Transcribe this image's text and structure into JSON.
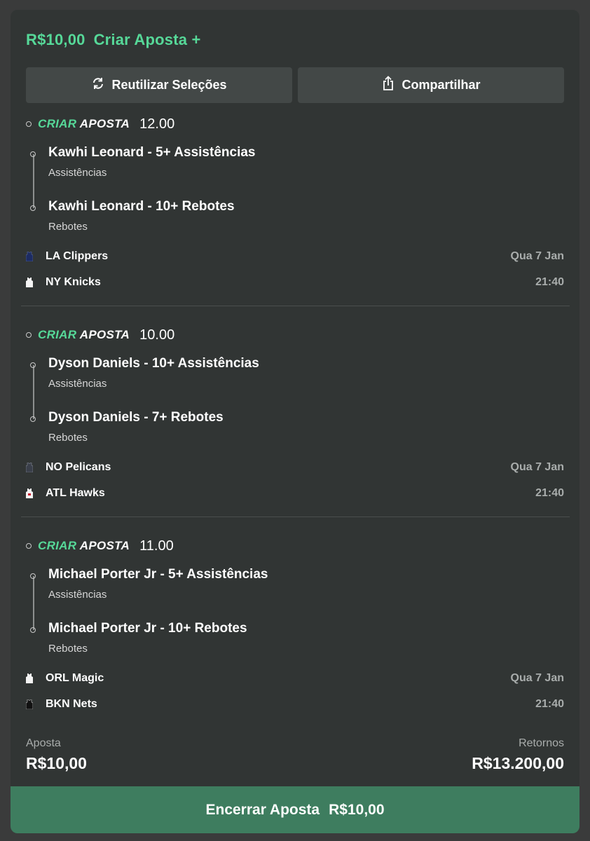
{
  "header": {
    "stake": "R$10,00",
    "create_bet": "Criar Aposta +"
  },
  "buttons": {
    "reuse": "Reutilizar Seleções",
    "share": "Compartilhar"
  },
  "logo": {
    "part1": "CRIAR",
    "part2": "APOSTA"
  },
  "bets": [
    {
      "odds": "12.00",
      "selections": [
        {
          "title": "Kawhi Leonard - 5+ Assistências",
          "market": "Assistências"
        },
        {
          "title": "Kawhi Leonard - 10+ Rebotes",
          "market": "Rebotes"
        }
      ],
      "home_team": "LA Clippers",
      "away_team": "NY Knicks",
      "date": "Qua 7 Jan",
      "time": "21:40",
      "home_color": "#1d2c63",
      "away_color": "#f4f4f4"
    },
    {
      "odds": "10.00",
      "selections": [
        {
          "title": "Dyson Daniels - 10+ Assistências",
          "market": "Assistências"
        },
        {
          "title": "Dyson Daniels - 7+ Rebotes",
          "market": "Rebotes"
        }
      ],
      "home_team": "NO Pelicans",
      "away_team": "ATL Hawks",
      "date": "Qua 7 Jan",
      "time": "21:40",
      "home_color": "#3a3f4a",
      "away_color": "#f4f4f4"
    },
    {
      "odds": "11.00",
      "selections": [
        {
          "title": "Michael Porter Jr - 5+ Assistências",
          "market": "Assistências"
        },
        {
          "title": "Michael Porter Jr - 10+ Rebotes",
          "market": "Rebotes"
        }
      ],
      "home_team": "ORL Magic",
      "away_team": "BKN Nets",
      "date": "Qua 7 Jan",
      "time": "21:40",
      "home_color": "#f4f4f4",
      "away_color": "#111111"
    }
  ],
  "summary": {
    "stake_label": "Aposta",
    "stake_value": "R$10,00",
    "returns_label": "Retornos",
    "returns_value": "R$13.200,00"
  },
  "cashout": {
    "label": "Encerrar Aposta",
    "value": "R$10,00"
  },
  "colors": {
    "accent": "#56d898",
    "cashout_bg": "#3e7d5f",
    "card_bg": "#313534",
    "button_bg": "#434847"
  }
}
